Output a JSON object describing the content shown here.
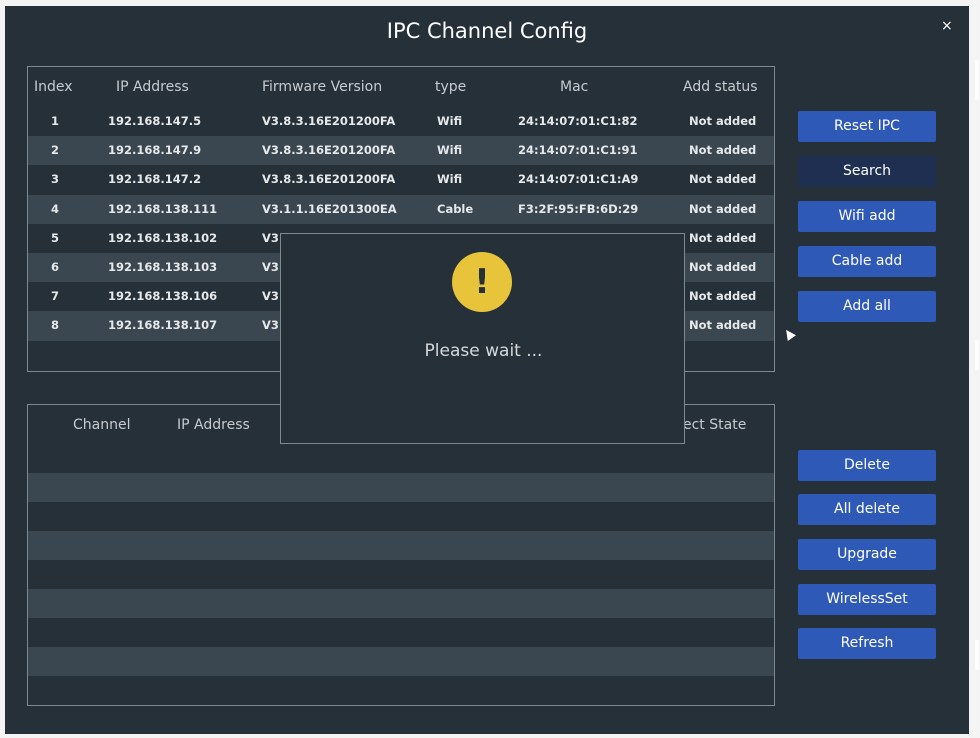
{
  "window": {
    "title": "IPC Channel Config",
    "close_symbol": "×"
  },
  "ipc_table": {
    "headers": [
      "Index",
      "IP Address",
      "Firmware Version",
      "type",
      "Mac",
      "Add status"
    ],
    "rows": [
      {
        "index": "1",
        "ip": "192.168.147.5",
        "firmware": "V3.8.3.16E201200FA",
        "type": "Wifi",
        "mac": "24:14:07:01:C1:82",
        "status": "Not added"
      },
      {
        "index": "2",
        "ip": "192.168.147.9",
        "firmware": "V3.8.3.16E201200FA",
        "type": "Wifi",
        "mac": "24:14:07:01:C1:91",
        "status": "Not added"
      },
      {
        "index": "3",
        "ip": "192.168.147.2",
        "firmware": "V3.8.3.16E201200FA",
        "type": "Wifi",
        "mac": "24:14:07:01:C1:A9",
        "status": "Not added"
      },
      {
        "index": "4",
        "ip": "192.168.138.111",
        "firmware": "V3.1.1.16E201300EA",
        "type": "Cable",
        "mac": "F3:2F:95:FB:6D:29",
        "status": "Not added"
      },
      {
        "index": "5",
        "ip": "192.168.138.102",
        "firmware": "V3",
        "type": "",
        "mac": "",
        "status": "Not added"
      },
      {
        "index": "6",
        "ip": "192.168.138.103",
        "firmware": "V3",
        "type": "",
        "mac": "",
        "status": "Not added"
      },
      {
        "index": "7",
        "ip": "192.168.138.106",
        "firmware": "V3",
        "type": "",
        "mac": "",
        "status": "Not added"
      },
      {
        "index": "8",
        "ip": "192.168.138.107",
        "firmware": "V3",
        "type": "",
        "mac": "",
        "status": "Not added"
      }
    ]
  },
  "channel_table": {
    "headers": [
      "Channel",
      "IP Address",
      "ect State"
    ]
  },
  "buttons_top": [
    "Reset IPC",
    "Search",
    "Wifi add",
    "Cable add",
    "Add all"
  ],
  "buttons_bottom": [
    "Delete",
    "All delete",
    "Upgrade",
    "WirelessSet",
    "Refresh"
  ],
  "dialog": {
    "icon_symbol": "!",
    "message": "Please wait ..."
  },
  "colors": {
    "background": "#263038",
    "row_alt": "#3a4650",
    "button": "#2e59b6",
    "button_active": "#1e2f52",
    "warning": "#e7c43a"
  }
}
